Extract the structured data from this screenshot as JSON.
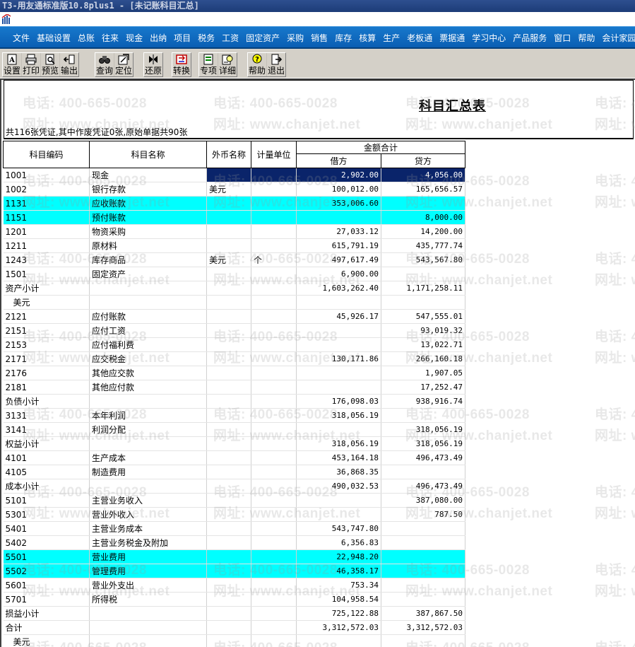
{
  "window": {
    "title": "T3-用友通标准版10.8plus1 - [未记账科目汇总]"
  },
  "menu": [
    "文件",
    "基础设置",
    "总账",
    "往来",
    "现金",
    "出纳",
    "项目",
    "税务",
    "工资",
    "固定资产",
    "采购",
    "销售",
    "库存",
    "核算",
    "生产",
    "老板通",
    "票据通",
    "学习中心",
    "产品服务",
    "窗口",
    "帮助",
    "会计家园"
  ],
  "toolbar": {
    "groups": [
      [
        {
          "label": "设置",
          "icon": "settings-icon"
        },
        {
          "label": "打印",
          "icon": "print-icon"
        },
        {
          "label": "预览",
          "icon": "preview-icon"
        },
        {
          "label": "输出",
          "icon": "export-icon"
        }
      ],
      [
        {
          "label": "查询",
          "icon": "query-icon"
        },
        {
          "label": "定位",
          "icon": "locate-icon"
        }
      ],
      [
        {
          "label": "还原",
          "icon": "restore-icon"
        }
      ],
      [
        {
          "label": "转换",
          "icon": "convert-icon"
        }
      ],
      [
        {
          "label": "专项",
          "icon": "special-icon"
        },
        {
          "label": "详细",
          "icon": "detail-icon"
        }
      ],
      [
        {
          "label": "帮助",
          "icon": "help-icon"
        },
        {
          "label": "退出",
          "icon": "exit-icon"
        }
      ]
    ]
  },
  "report": {
    "title": "科目汇总表",
    "summary": "共116张凭证,其中作废凭证0张,原始单据共90张"
  },
  "watermark": {
    "phone": "电话: 400-665-0028",
    "site": "网址: www.chanjet.net"
  },
  "table": {
    "headers": {
      "code": "科目编码",
      "name": "科目名称",
      "currency": "外币名称",
      "unit": "计量单位",
      "amount_group": "金额合计",
      "debit": "借方",
      "credit": "贷方"
    },
    "rows": [
      {
        "code": "1001",
        "name": "现金",
        "currency": "",
        "unit": "",
        "debit": "2,902.00",
        "credit": "4,056.00",
        "style": "selected"
      },
      {
        "code": "1002",
        "name": "银行存款",
        "currency": "美元",
        "unit": "",
        "debit": "100,012.00",
        "credit": "165,656.57",
        "style": ""
      },
      {
        "code": "1131",
        "name": "应收账款",
        "currency": "",
        "unit": "",
        "debit": "353,006.60",
        "credit": "",
        "style": "highlight"
      },
      {
        "code": "1151",
        "name": "预付账款",
        "currency": "",
        "unit": "",
        "debit": "",
        "credit": "8,000.00",
        "style": "highlight"
      },
      {
        "code": "1201",
        "name": "物资采购",
        "currency": "",
        "unit": "",
        "debit": "27,033.12",
        "credit": "14,200.00",
        "style": ""
      },
      {
        "code": "1211",
        "name": "原材料",
        "currency": "",
        "unit": "",
        "debit": "615,791.19",
        "credit": "435,777.74",
        "style": ""
      },
      {
        "code": "1243",
        "name": "库存商品",
        "currency": "美元",
        "unit": "个",
        "debit": "497,617.49",
        "credit": "543,567.80",
        "style": ""
      },
      {
        "code": "1501",
        "name": "固定资产",
        "currency": "",
        "unit": "",
        "debit": "6,900.00",
        "credit": "",
        "style": ""
      },
      {
        "code": "资产小计",
        "name": "",
        "currency": "",
        "unit": "",
        "debit": "1,603,262.40",
        "credit": "1,171,258.11",
        "style": ""
      },
      {
        "code": "美元",
        "name": "",
        "currency": "",
        "unit": "",
        "debit": "",
        "credit": "",
        "style": "indent"
      },
      {
        "code": "2121",
        "name": "应付账款",
        "currency": "",
        "unit": "",
        "debit": "45,926.17",
        "credit": "547,555.01",
        "style": ""
      },
      {
        "code": "2151",
        "name": "应付工资",
        "currency": "",
        "unit": "",
        "debit": "",
        "credit": "93,019.32",
        "style": ""
      },
      {
        "code": "2153",
        "name": "应付福利费",
        "currency": "",
        "unit": "",
        "debit": "",
        "credit": "13,022.71",
        "style": ""
      },
      {
        "code": "2171",
        "name": "应交税金",
        "currency": "",
        "unit": "",
        "debit": "130,171.86",
        "credit": "266,160.18",
        "style": ""
      },
      {
        "code": "2176",
        "name": "其他应交款",
        "currency": "",
        "unit": "",
        "debit": "",
        "credit": "1,907.05",
        "style": ""
      },
      {
        "code": "2181",
        "name": "其他应付款",
        "currency": "",
        "unit": "",
        "debit": "",
        "credit": "17,252.47",
        "style": ""
      },
      {
        "code": "负债小计",
        "name": "",
        "currency": "",
        "unit": "",
        "debit": "176,098.03",
        "credit": "938,916.74",
        "style": ""
      },
      {
        "code": "3131",
        "name": "本年利润",
        "currency": "",
        "unit": "",
        "debit": "318,056.19",
        "credit": "",
        "style": ""
      },
      {
        "code": "3141",
        "name": "利润分配",
        "currency": "",
        "unit": "",
        "debit": "",
        "credit": "318,056.19",
        "style": ""
      },
      {
        "code": "权益小计",
        "name": "",
        "currency": "",
        "unit": "",
        "debit": "318,056.19",
        "credit": "318,056.19",
        "style": ""
      },
      {
        "code": "4101",
        "name": "生产成本",
        "currency": "",
        "unit": "",
        "debit": "453,164.18",
        "credit": "496,473.49",
        "style": ""
      },
      {
        "code": "4105",
        "name": "制造费用",
        "currency": "",
        "unit": "",
        "debit": "36,868.35",
        "credit": "",
        "style": ""
      },
      {
        "code": "成本小计",
        "name": "",
        "currency": "",
        "unit": "",
        "debit": "490,032.53",
        "credit": "496,473.49",
        "style": ""
      },
      {
        "code": "5101",
        "name": "主营业务收入",
        "currency": "",
        "unit": "",
        "debit": "",
        "credit": "387,080.00",
        "style": ""
      },
      {
        "code": "5301",
        "name": "营业外收入",
        "currency": "",
        "unit": "",
        "debit": "",
        "credit": "787.50",
        "style": ""
      },
      {
        "code": "5401",
        "name": "主营业务成本",
        "currency": "",
        "unit": "",
        "debit": "543,747.80",
        "credit": "",
        "style": ""
      },
      {
        "code": "5402",
        "name": "主营业务税金及附加",
        "currency": "",
        "unit": "",
        "debit": "6,356.83",
        "credit": "",
        "style": ""
      },
      {
        "code": "5501",
        "name": "营业费用",
        "currency": "",
        "unit": "",
        "debit": "22,948.20",
        "credit": "",
        "style": "highlight"
      },
      {
        "code": "5502",
        "name": "管理费用",
        "currency": "",
        "unit": "",
        "debit": "46,358.17",
        "credit": "",
        "style": "highlight"
      },
      {
        "code": "5601",
        "name": "营业外支出",
        "currency": "",
        "unit": "",
        "debit": "753.34",
        "credit": "",
        "style": ""
      },
      {
        "code": "5701",
        "name": "所得税",
        "currency": "",
        "unit": "",
        "debit": "104,958.54",
        "credit": "",
        "style": ""
      },
      {
        "code": "损益小计",
        "name": "",
        "currency": "",
        "unit": "",
        "debit": "725,122.88",
        "credit": "387,867.50",
        "style": ""
      },
      {
        "code": "合计",
        "name": "",
        "currency": "",
        "unit": "",
        "debit": "3,312,572.03",
        "credit": "3,312,572.03",
        "style": ""
      },
      {
        "code": "美元",
        "name": "",
        "currency": "",
        "unit": "",
        "debit": "",
        "credit": "",
        "style": "indent"
      }
    ]
  },
  "colors": {
    "menubar": "#0a5eb3",
    "highlight_row": "#00ffff",
    "selection": "#0a246a",
    "titlebar": "#1d3c78"
  }
}
